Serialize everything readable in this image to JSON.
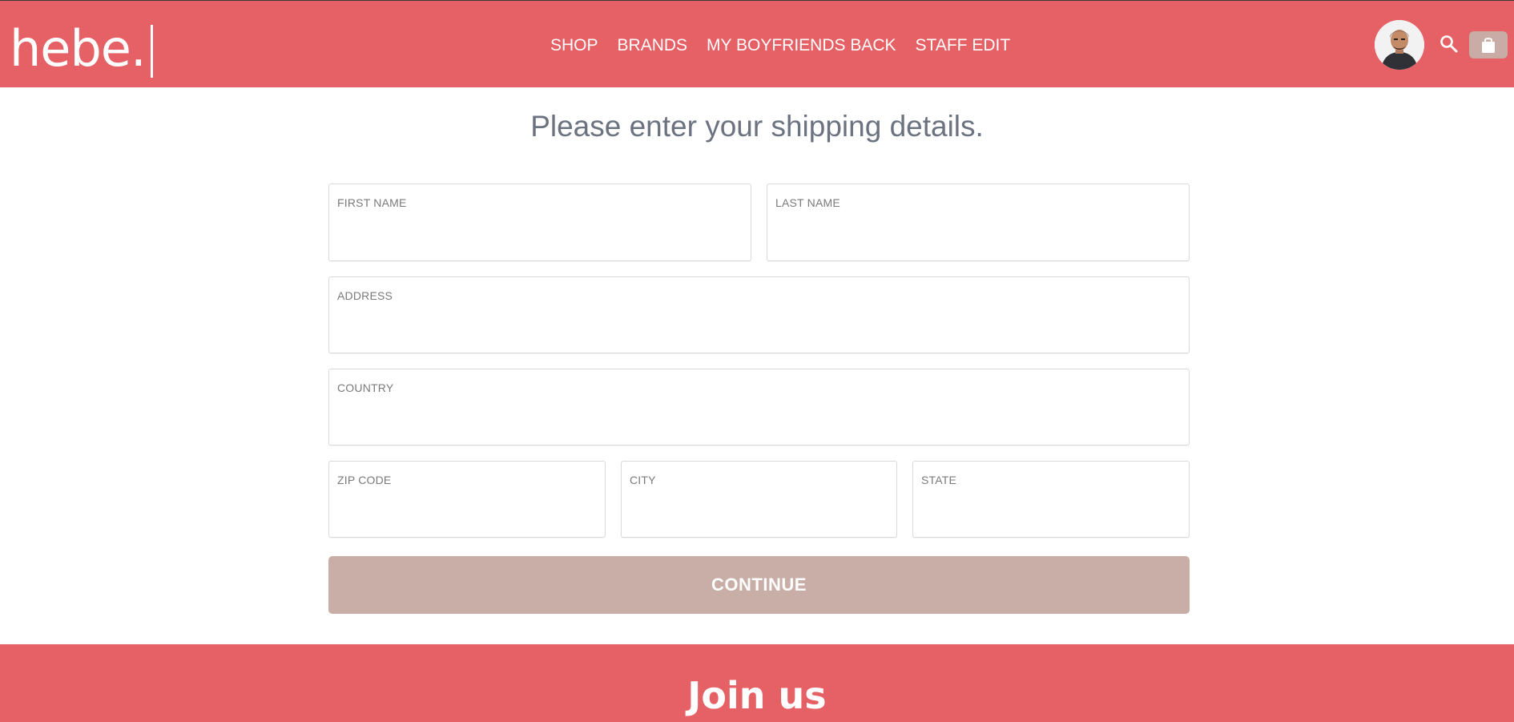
{
  "header": {
    "logo": "hebe.",
    "nav": [
      "SHOP",
      "BRANDS",
      "MY BOYFRIENDS BACK",
      "STAFF EDIT"
    ],
    "icons": {
      "avatar": "user-avatar",
      "search": "search-icon",
      "bag": "shopping-bag-icon"
    }
  },
  "main": {
    "title": "Please enter your shipping details.",
    "fields": {
      "first_name": {
        "label": "FIRST NAME",
        "value": ""
      },
      "last_name": {
        "label": "LAST NAME",
        "value": ""
      },
      "address": {
        "label": "ADDRESS",
        "value": ""
      },
      "country": {
        "label": "COUNTRY",
        "value": ""
      },
      "zip": {
        "label": "ZIP CODE",
        "value": ""
      },
      "city": {
        "label": "CITY",
        "value": ""
      },
      "state": {
        "label": "STATE",
        "value": ""
      }
    },
    "continue_label": "CONTINUE"
  },
  "footer": {
    "title": "Join us"
  },
  "colors": {
    "brand": "#e66165",
    "button": "#c9aea7",
    "title_text": "#6b7280",
    "label_text": "#7a7a7a"
  }
}
